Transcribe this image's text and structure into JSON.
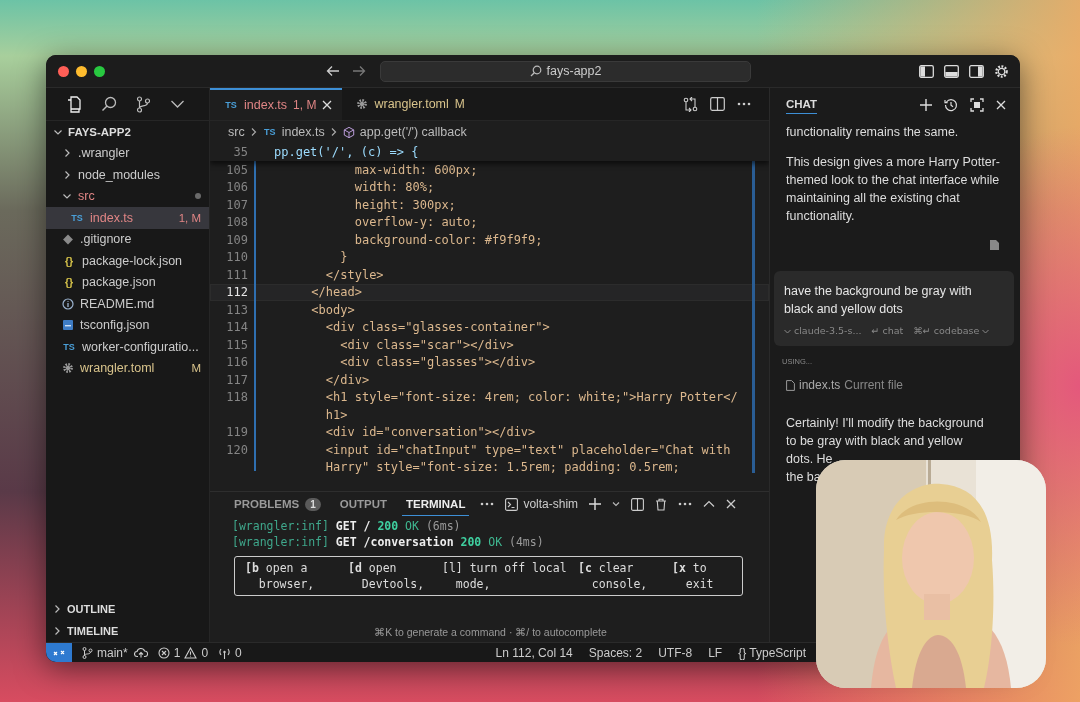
{
  "window": {
    "search": "fays-app2"
  },
  "explorer": {
    "title": "FAYS-APP2",
    "expanded": true,
    "items": [
      {
        "label": ".wrangler",
        "kind": "folder",
        "expanded": false,
        "selected": false
      },
      {
        "label": "node_modules",
        "kind": "folder",
        "expanded": false,
        "selected": false
      },
      {
        "label": "src",
        "kind": "folder",
        "expanded": true,
        "color": "#e08585",
        "selected": false,
        "children": [
          {
            "label": "index.ts",
            "kind": "ts",
            "icon": "TS",
            "badge": "1, M",
            "color": "#e08585",
            "selected": true
          }
        ]
      },
      {
        "label": ".gitignore",
        "kind": "git",
        "selected": false
      },
      {
        "label": "package-lock.json",
        "kind": "json",
        "icon": "{}",
        "selected": false
      },
      {
        "label": "package.json",
        "kind": "json",
        "icon": "{}",
        "selected": false
      },
      {
        "label": "README.md",
        "kind": "info",
        "selected": false
      },
      {
        "label": "tsconfig.json",
        "kind": "config",
        "selected": false
      },
      {
        "label": "worker-configuratio...",
        "kind": "ts",
        "icon": "TS",
        "selected": false
      },
      {
        "label": "wrangler.toml",
        "kind": "gear",
        "badge": "M",
        "color": "#d9c48c",
        "selected": false
      }
    ]
  },
  "sections": [
    {
      "label": "OUTLINE",
      "expanded": false
    },
    {
      "label": "TIMELINE",
      "expanded": false
    }
  ],
  "tabs": [
    {
      "label": "index.ts",
      "kind": "ts",
      "icon": "TS",
      "badge": "1, M",
      "color": "#e08585",
      "selected": true
    },
    {
      "label": "wrangler.toml",
      "kind": "gear",
      "badge": "M",
      "color": "#d9c48c",
      "selected": false
    }
  ],
  "breadcrumb": [
    {
      "label": "src",
      "kind": "folder"
    },
    {
      "label": "index.ts",
      "kind": "ts",
      "icon": "TS"
    },
    {
      "label": "app.get('/') callback",
      "kind": "symbol"
    }
  ],
  "sticky_line": {
    "number": "35",
    "text": "pp.get('/', (c) => {"
  },
  "code_lines": [
    {
      "number": "105",
      "text": "            max-width: 600px;",
      "selected": false
    },
    {
      "number": "106",
      "text": "            width: 80%;",
      "selected": false
    },
    {
      "number": "107",
      "text": "            height: 300px;",
      "selected": false
    },
    {
      "number": "108",
      "text": "            overflow-y: auto;",
      "selected": false
    },
    {
      "number": "109",
      "text": "            background-color: #f9f9f9;",
      "selected": false
    },
    {
      "number": "110",
      "text": "          }",
      "selected": false
    },
    {
      "number": "111",
      "text": "        </style>",
      "selected": false
    },
    {
      "number": "112",
      "text": "      </head>",
      "selected": true
    },
    {
      "number": "113",
      "text": "      <body>",
      "selected": false
    },
    {
      "number": "114",
      "text": "        <div class=\"glasses-container\">",
      "selected": false
    },
    {
      "number": "115",
      "text": "          <div class=\"scar\"></div>",
      "selected": false
    },
    {
      "number": "116",
      "text": "          <div class=\"glasses\"></div>",
      "selected": false
    },
    {
      "number": "117",
      "text": "        </div>",
      "selected": false
    },
    {
      "number": "118",
      "text": "        <h1 style=\"font-size: 4rem; color: white;\">Harry Potter</",
      "selected": false
    },
    {
      "text": "        h1>"
    },
    {
      "number": "119",
      "text": "        <div id=\"conversation\"></div>",
      "selected": false
    },
    {
      "number": "120",
      "text": "        <input id=\"chatInput\" type=\"text\" placeholder=\"Chat with",
      "selected": false
    },
    {
      "text": "        Harry\" style=\"font-size: 1.5rem; padding: 0.5rem;"
    }
  ],
  "panel": {
    "tabs": [
      {
        "label": "PROBLEMS",
        "badge": "1",
        "selected": false
      },
      {
        "label": "OUTPUT",
        "selected": false
      },
      {
        "label": "TERMINAL",
        "selected": true
      }
    ],
    "terminal_name": "volta-shim",
    "lines": [
      [
        {
          "text": "[wrangler:inf]",
          "kind": "tag"
        },
        {
          "text": " GET / ",
          "kind": "method"
        },
        {
          "text": "200",
          "kind": "status"
        },
        {
          "text": " OK",
          "kind": "ok"
        },
        {
          "text": " (6ms)",
          "kind": "note"
        }
      ],
      [
        {
          "text": "[wrangler:inf]",
          "kind": "tag"
        },
        {
          "text": " GET /conversation ",
          "kind": "method"
        },
        {
          "text": "200",
          "kind": "status"
        },
        {
          "text": " OK",
          "kind": "ok"
        },
        {
          "text": " (4ms)",
          "kind": "note"
        }
      ]
    ],
    "shortcuts": [
      {
        "lines": [
          "**[b** open a",
          "browser,"
        ]
      },
      {
        "lines": [
          "**[d** open",
          "Devtools,"
        ]
      },
      {
        "lines": [
          "[l] turn off local",
          "mode,"
        ]
      },
      {
        "lines": [
          "**[c** clear",
          "console,"
        ]
      },
      {
        "lines": [
          "**[x** to",
          "exit"
        ]
      }
    ],
    "hint": "⌘K to generate a command · ⌘/ to autocomplete"
  },
  "chat": {
    "title": "CHAT",
    "paragraphs": [
      "functionality remains the same.",
      "This design gives a more Harry Potter-themed look to the chat interface while maintaining all the existing chat functionality."
    ],
    "input": {
      "value": "have the background be gray with black and yellow dots",
      "model": "claude-3.5-s...",
      "options": [
        "↵ chat",
        "⌘↵ codebase"
      ]
    },
    "context_label": "USING...",
    "context_file": {
      "name": "index.ts",
      "note": "Current file"
    },
    "reply_lines": [
      "Certainly! I'll modify the background",
      "to be gray with black and yellow",
      "dots. He",
      "the ba"
    ]
  },
  "status_bar": {
    "branch": "main*",
    "errors": "1",
    "warnings": "0",
    "ports": "0",
    "right": [
      "Ln 112, Col 14",
      "Spaces: 2",
      "UTF-8",
      "LF",
      "{} TypeScript"
    ]
  }
}
